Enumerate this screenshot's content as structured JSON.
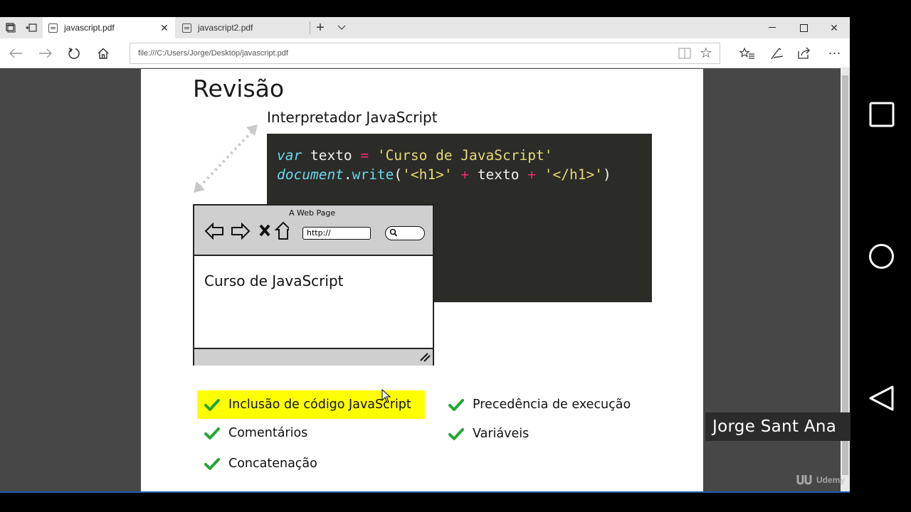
{
  "browser": {
    "tabs": [
      {
        "label": "javascript.pdf",
        "active": true
      },
      {
        "label": "javascript2.pdf",
        "active": false
      }
    ],
    "address": "file:///C:/Users/Jorge/Desktop/javascript.pdf"
  },
  "slide": {
    "title": "Revisão",
    "interpreter_label": "Interpretador JavaScript",
    "code": {
      "line1": {
        "kw": "var",
        "ident": " texto ",
        "op": "=",
        "str": " 'Curso de JavaScript'"
      },
      "line2": {
        "obj": "document",
        "dot": ".",
        "fn": "write",
        "p1": "(",
        "s1": "'<h1>'",
        "op1": " + ",
        "ident": "texto",
        "op2": " + ",
        "s2": "'</h1>'",
        "p2": ")"
      }
    },
    "mock_browser": {
      "title": "A Web Page",
      "url": "http://",
      "content": "Curso de JavaScript"
    },
    "checklist": [
      "Inclusão de código JavaScript",
      "Comentários",
      "Concatenação",
      "Precedência de execução",
      "Variáveis"
    ],
    "highlighted_item": "Inclusão de código JavaScript"
  },
  "overlay": {
    "instructor_name": "Jorge Sant Ana",
    "watermark": "Udemy"
  },
  "colors": {
    "highlight": "#ffff00",
    "check": "#22a637",
    "code_bg": "#2b2b28",
    "viewer_bg": "#474747"
  }
}
